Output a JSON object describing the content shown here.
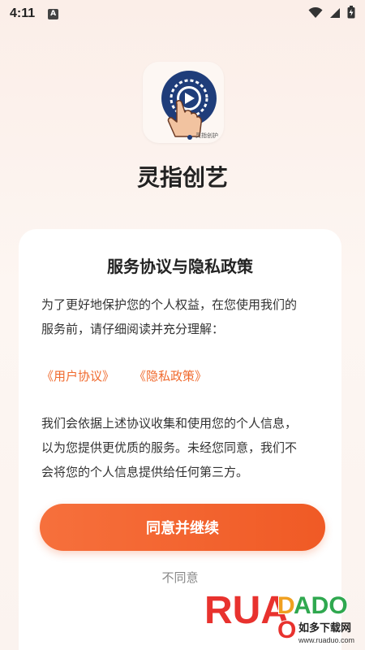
{
  "status_bar": {
    "time": "4:11",
    "a_glyph": "A"
  },
  "app": {
    "name": "灵指创艺",
    "icon_caption": "灵指创护"
  },
  "dialog": {
    "title": "服务协议与隐私政策",
    "intro_line1": "为了更好地保护您的个人权益，在您使用我们的",
    "intro_line2": "服务前，请仔细阅读并充分理解：",
    "link_user_agreement": "《用户协议》",
    "link_privacy_policy": "《隐私政策》",
    "body_line1": "我们会依据上述协议收集和使用您的个人信息，",
    "body_line2": "以为您提供更优质的服务。未经您同意，我们不",
    "body_line3": "会将您的个人信息提供给任何第三方。",
    "agree_label": "同意并继续",
    "disagree_label": "不同意"
  },
  "watermark": {
    "brand": "RUAODADO",
    "site_cn": "如多下载网",
    "site_url": "www.ruaduo.com"
  },
  "colors": {
    "accent": "#f05a25",
    "link": "#f06a2e",
    "icon_circle": "#1f3d7a"
  }
}
